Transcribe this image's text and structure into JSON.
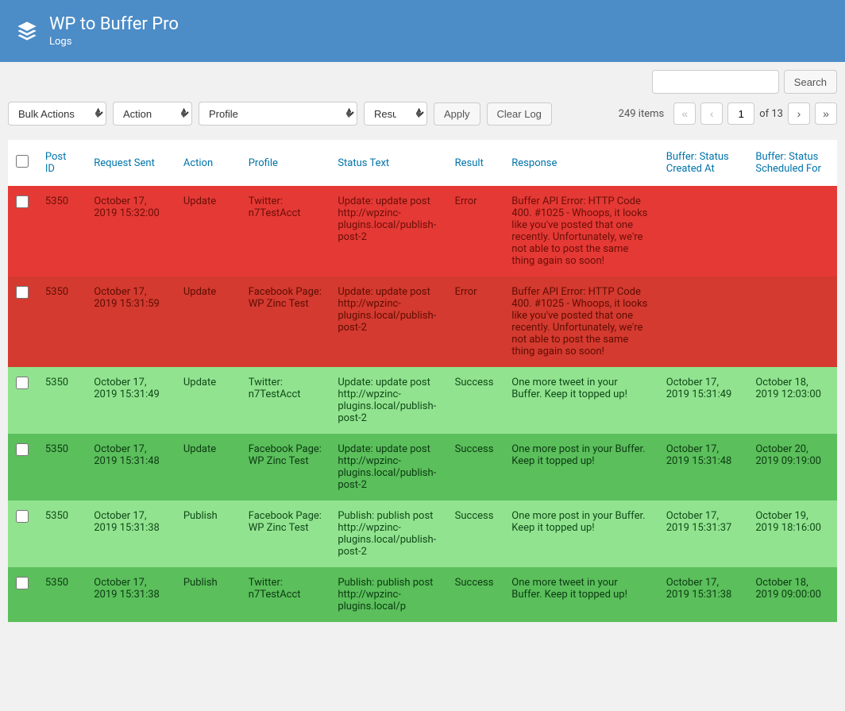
{
  "header": {
    "title": "WP to Buffer Pro",
    "subtitle": "Logs"
  },
  "search": {
    "button": "Search"
  },
  "filters": {
    "bulk": "Bulk Actions",
    "action": "Action",
    "profile": "Profile",
    "result": "Result",
    "apply": "Apply",
    "clear": "Clear Log"
  },
  "pagination": {
    "items": "249 items",
    "page": "1",
    "of": "of 13"
  },
  "columns": {
    "postid": "Post ID",
    "request": "Request Sent",
    "action": "Action",
    "profile": "Profile",
    "status": "Status Text",
    "result": "Result",
    "response": "Response",
    "created": "Buffer: Status Created At",
    "scheduled": "Buffer: Status Scheduled For"
  },
  "rows": [
    {
      "postid": "5350",
      "request": "October 17, 2019 15:32:00",
      "action": "Update",
      "profile": "Twitter: n7TestAcct",
      "status": "Update: update post http://wpzinc-plugins.local/publish-post-2",
      "result": "Error",
      "response": "Buffer API Error: HTTP Code 400. #1025 - Whoops, it looks like you've posted that one recently. Unfortunately, we're not able to post the same thing again so soon!",
      "created": "",
      "scheduled": ""
    },
    {
      "postid": "5350",
      "request": "October 17, 2019 15:31:59",
      "action": "Update",
      "profile": "Facebook Page: WP Zinc Test",
      "status": "Update: update post http://wpzinc-plugins.local/publish-post-2",
      "result": "Error",
      "response": "Buffer API Error: HTTP Code 400. #1025 - Whoops, it looks like you've posted that one recently. Unfortunately, we're not able to post the same thing again so soon!",
      "created": "",
      "scheduled": ""
    },
    {
      "postid": "5350",
      "request": "October 17, 2019 15:31:49",
      "action": "Update",
      "profile": "Twitter: n7TestAcct",
      "status": "Update: update post http://wpzinc-plugins.local/publish-post-2",
      "result": "Success",
      "response": "One more tweet in your Buffer. Keep it topped up!",
      "created": "October 17, 2019 15:31:49",
      "scheduled": "October 18, 2019 12:03:00"
    },
    {
      "postid": "5350",
      "request": "October 17, 2019 15:31:48",
      "action": "Update",
      "profile": "Facebook Page: WP Zinc Test",
      "status": "Update: update post http://wpzinc-plugins.local/publish-post-2",
      "result": "Success",
      "response": "One more post in your Buffer. Keep it topped up!",
      "created": "October 17, 2019 15:31:48",
      "scheduled": "October 20, 2019 09:19:00"
    },
    {
      "postid": "5350",
      "request": "October 17, 2019 15:31:38",
      "action": "Publish",
      "profile": "Facebook Page: WP Zinc Test",
      "status": "Publish: publish post http://wpzinc-plugins.local/publish-post-2",
      "result": "Success",
      "response": "One more post in your Buffer. Keep it topped up!",
      "created": "October 17, 2019 15:31:37",
      "scheduled": "October 19, 2019 18:16:00"
    },
    {
      "postid": "5350",
      "request": "October 17, 2019 15:31:38",
      "action": "Publish",
      "profile": "Twitter: n7TestAcct",
      "status": "Publish: publish post http://wpzinc-plugins.local/p",
      "result": "Success",
      "response": "One more tweet in your Buffer. Keep it topped up!",
      "created": "October 17, 2019 15:31:38",
      "scheduled": "October 18, 2019 09:00:00"
    }
  ],
  "row_classes": [
    "row-error-1",
    "row-error-2",
    "row-success-1",
    "row-success-2",
    "row-success-3",
    "row-success-4"
  ]
}
